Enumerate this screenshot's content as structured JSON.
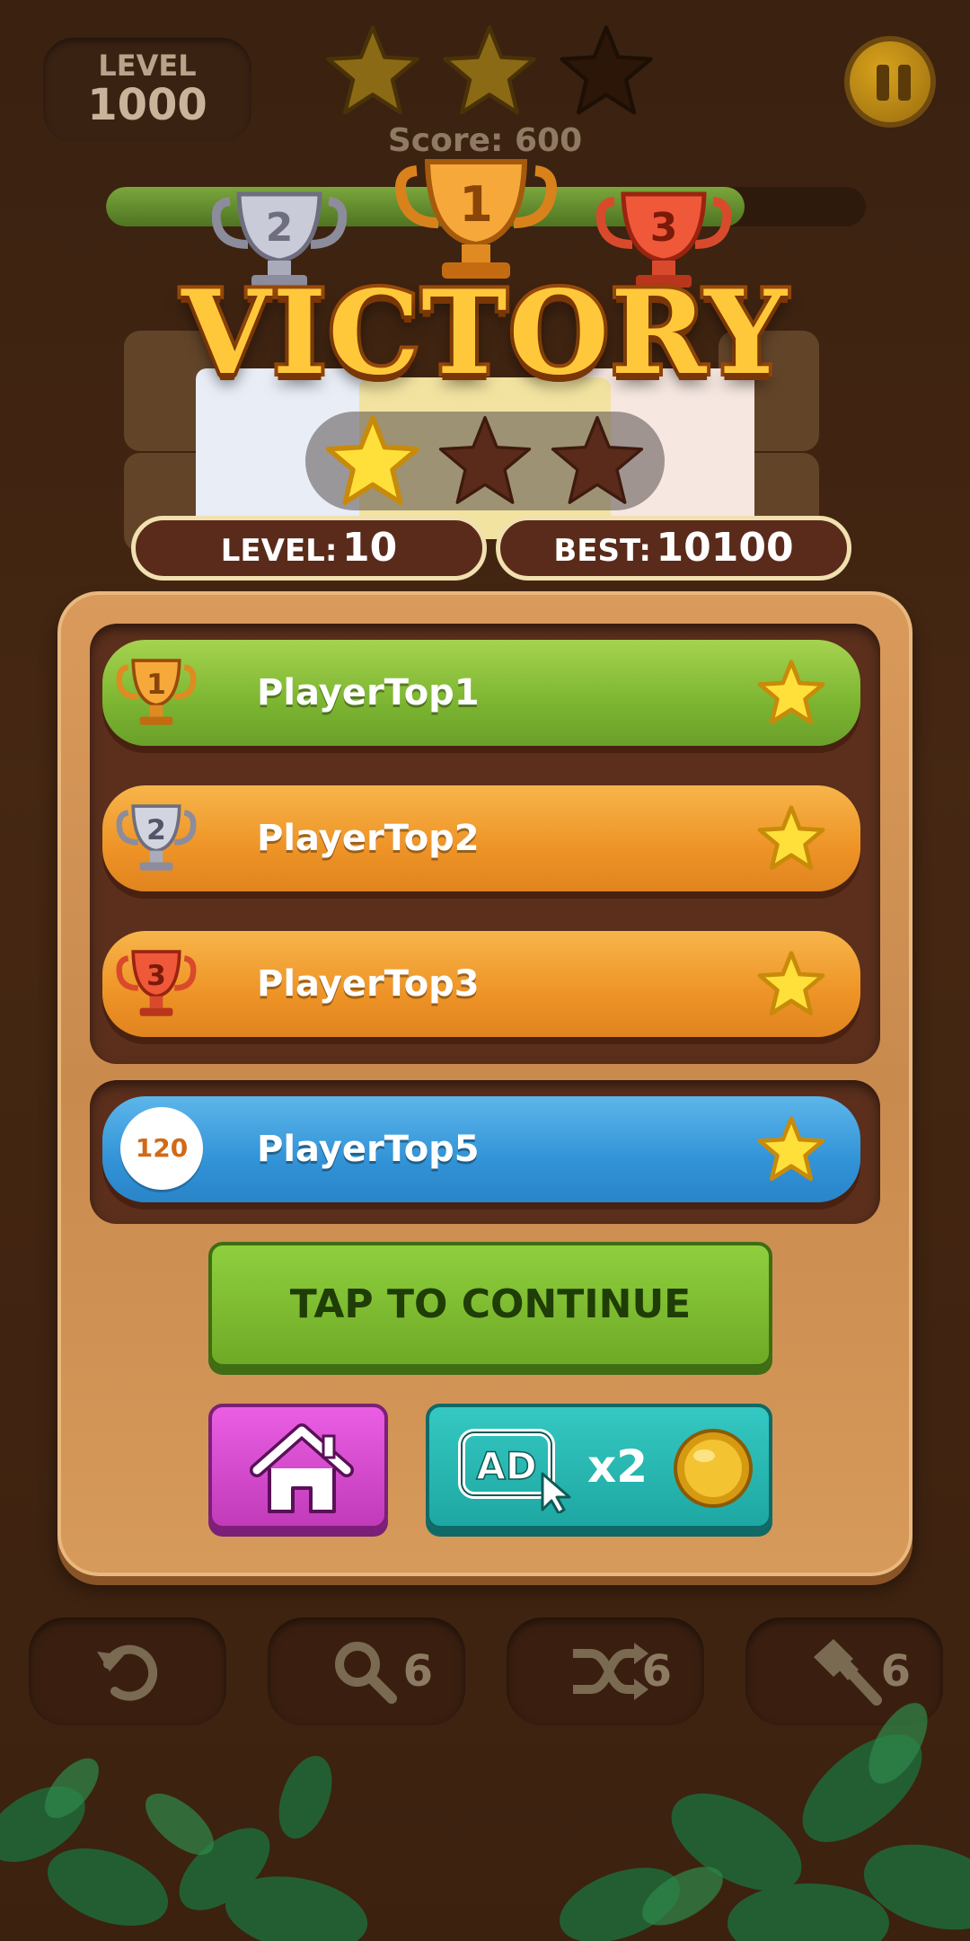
{
  "hud": {
    "level_label": "LEVEL",
    "level_value": "1000",
    "stars_filled": 2,
    "stars_total": 3,
    "score_text": "Score: 600",
    "progress_fraction": 0.84
  },
  "result": {
    "title": "VICTORY",
    "trophy_ranks": [
      "2",
      "1",
      "3"
    ],
    "stars_earned": 1,
    "stars_total": 3,
    "level_label": "LEVEL:",
    "level_value": "10",
    "best_label": "BEST:",
    "best_value": "10100"
  },
  "leaderboard": {
    "rows": [
      {
        "rank": "1",
        "name": "PlayerTop1",
        "style": "green"
      },
      {
        "rank": "2",
        "name": "PlayerTop2",
        "style": "orange"
      },
      {
        "rank": "3",
        "name": "PlayerTop3",
        "style": "orange"
      }
    ],
    "self": {
      "rank": "120",
      "name": "PlayerTop5",
      "style": "blue"
    }
  },
  "actions": {
    "continue_label": "TAP TO CONTINUE",
    "home_icon": "home-icon",
    "ad_icon": "ad-icon",
    "ad_multiplier": "x2",
    "coin_icon": "coin-icon"
  },
  "tools": [
    {
      "icon": "undo-icon",
      "count": ""
    },
    {
      "icon": "magnifier-icon",
      "count": "6"
    },
    {
      "icon": "shuffle-icon",
      "count": "6"
    },
    {
      "icon": "brush-icon",
      "count": "6"
    }
  ],
  "colors": {
    "gold": "#ffc83a",
    "green_row": "#7cb531",
    "orange_row": "#ee9326",
    "blue_row": "#3293d7",
    "continue": "#6faa26",
    "home": "#c13bb9",
    "ad": "#1ea7a2"
  }
}
